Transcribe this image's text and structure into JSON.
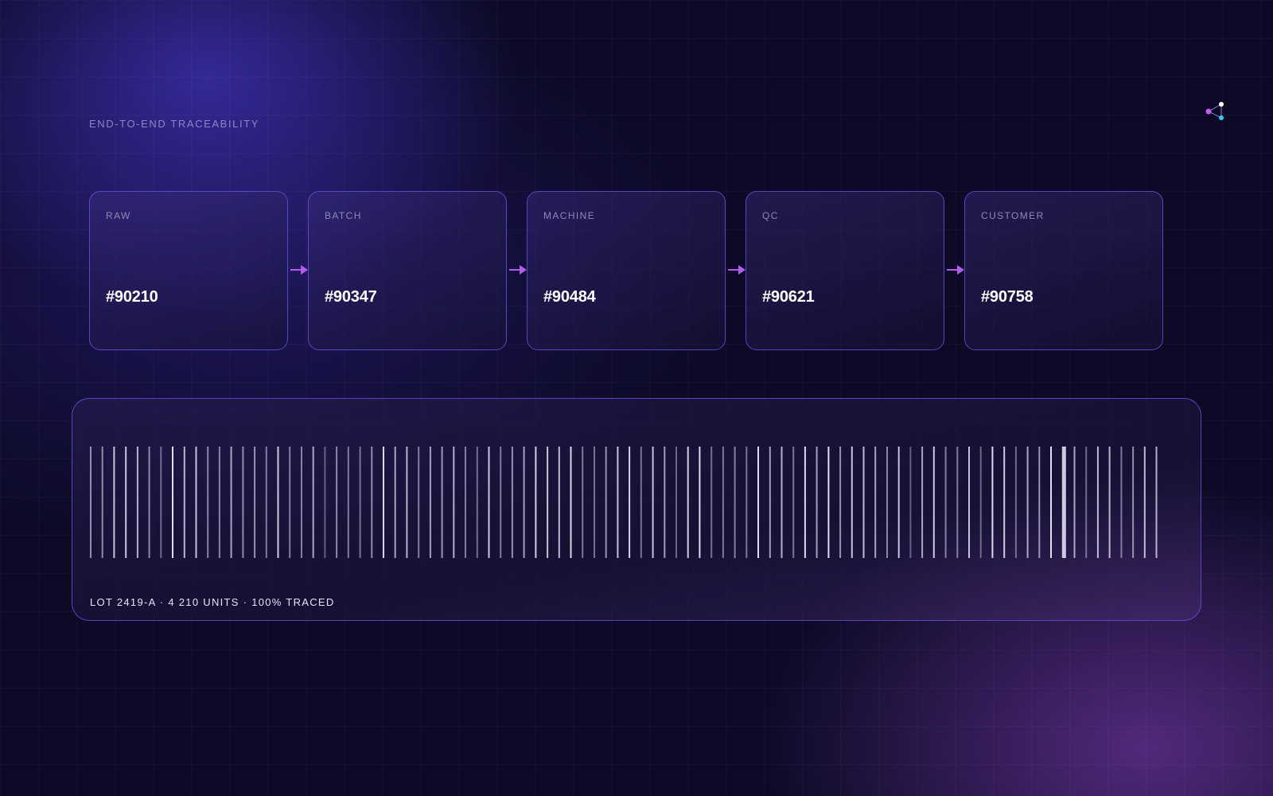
{
  "header": {
    "eyebrow": "END-TO-END TRACEABILITY"
  },
  "stages": [
    {
      "label": "RAW",
      "id": "#90210"
    },
    {
      "label": "BATCH",
      "id": "#90347"
    },
    {
      "label": "MACHINE",
      "id": "#90484"
    },
    {
      "label": "QC",
      "id": "#90621"
    },
    {
      "label": "CUSTOMER",
      "id": "#90758"
    }
  ],
  "barcode": {
    "caption": "LOT 2419-A · 4 210 UNITS · 100% TRACED",
    "highlight_index": 83
  },
  "icons": {
    "share": "share-nodes-icon",
    "arrow": "arrow-right-icon"
  },
  "colors": {
    "accent": "#b45cf0",
    "border": "#6f54e6",
    "node_pink": "#c85cf0",
    "node_cyan": "#38c8e8",
    "node_white": "#ffffff"
  }
}
